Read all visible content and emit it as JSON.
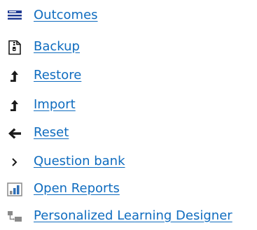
{
  "menu": {
    "items": [
      {
        "label": "Outcomes",
        "icon": "outcomes-list-icon"
      },
      {
        "label": "Backup",
        "icon": "backup-file-icon"
      },
      {
        "label": "Restore",
        "icon": "restore-arrow-up-icon"
      },
      {
        "label": "Import",
        "icon": "import-arrow-up-icon"
      },
      {
        "label": "Reset",
        "icon": "reset-arrow-left-icon"
      },
      {
        "label": "Question bank",
        "icon": "chevron-right-icon"
      },
      {
        "label": "Open Reports",
        "icon": "bar-chart-icon"
      },
      {
        "label": "Personalized Learning Designer",
        "icon": "pld-flow-icon"
      }
    ]
  },
  "colors": {
    "link": "#0f6cbf",
    "icon_dark": "#1a1a1a",
    "icon_blue": "#1f3a93",
    "chart_blue": "#2f6fb6",
    "chart_gray": "#8a8a8a"
  }
}
